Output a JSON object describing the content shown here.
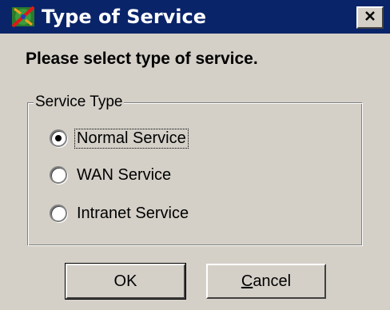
{
  "window": {
    "title": "Type of Service",
    "close_icon": "close-icon",
    "app_icon": "satellite-app-icon"
  },
  "dialog": {
    "prompt": "Please select type of service.",
    "group_label": "Service Type",
    "options": [
      {
        "label": "Normal Service",
        "selected": true
      },
      {
        "label": "WAN Service",
        "selected": false
      },
      {
        "label": "Intranet Service",
        "selected": false
      }
    ]
  },
  "buttons": {
    "ok_label": "OK",
    "cancel_mnemonic": "C",
    "cancel_rest": "ancel"
  },
  "colors": {
    "titlebar": "#0a246a",
    "face": "#d4d0c8"
  }
}
